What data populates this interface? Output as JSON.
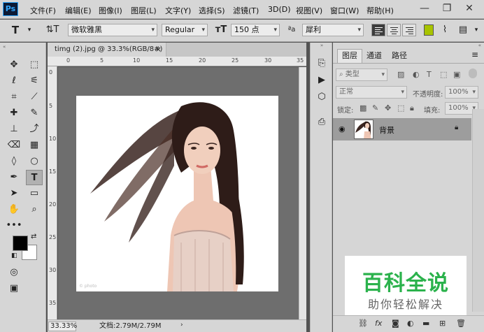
{
  "app": {
    "logo": "Ps"
  },
  "menu": [
    "文件(F)",
    "编辑(E)",
    "图像(I)",
    "图层(L)",
    "文字(Y)",
    "选择(S)",
    "滤镜(T)",
    "3D(D)",
    "视图(V)",
    "窗口(W)",
    "帮助(H)"
  ],
  "window_controls": {
    "minimize": "—",
    "restore": "❐",
    "close": "✕"
  },
  "options": {
    "tool_glyph": "T",
    "font_family": "微软雅黑",
    "font_style": "Regular",
    "font_size": "150 点",
    "aa_label": "ªa",
    "anti_alias": "犀利",
    "text_color": "#a8c400"
  },
  "document": {
    "tab_title": "timg (2).jpg @ 33.3%(RGB/8#)",
    "close": "×",
    "ruler_ticks": [
      "0",
      "5",
      "10",
      "15",
      "20",
      "25",
      "30",
      "35"
    ],
    "zoom": "33.33%",
    "doc_info": "文档:2.79M/2.79M",
    "canvas_color": "#6e6e6e"
  },
  "colors": {
    "foreground": "#000000",
    "background": "#ffffff"
  },
  "layers_panel": {
    "tabs": [
      "图层",
      "通道",
      "路径"
    ],
    "kind_filter": "类型",
    "blend_mode": "正常",
    "opacity_label": "不透明度:",
    "opacity_value": "100%",
    "lock_label": "锁定:",
    "fill_label": "填充:",
    "fill_value": "100%",
    "layer": {
      "name": "背景",
      "visible": true,
      "locked": true
    },
    "footer_icons": [
      "link-icon",
      "fx-icon",
      "mask-icon",
      "adjustment-icon",
      "group-icon",
      "new-layer-icon",
      "trash-icon"
    ]
  },
  "watermark": {
    "title": "百科全说",
    "subtitle": "助你轻松解决",
    "color": "#2bb24c"
  }
}
